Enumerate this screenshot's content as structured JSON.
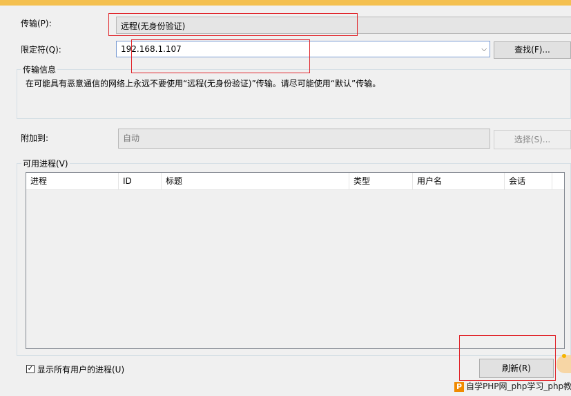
{
  "transport": {
    "label": "传输(P):",
    "value": "远程(无身份验证)"
  },
  "qualifier": {
    "label": "限定符(Q):",
    "value": "192.168.1.107",
    "find_button": "查找(F)..."
  },
  "transport_info": {
    "title": "传输信息",
    "text": "在可能具有恶意通信的网络上永远不要使用“远程(无身份验证)”传输。请尽可能使用“默认”传输。"
  },
  "attach_to": {
    "label": "附加到:",
    "value": "自动",
    "select_button": "选择(S)..."
  },
  "processes": {
    "title": "可用进程(V)",
    "columns": [
      "进程",
      "ID",
      "标题",
      "类型",
      "用户名",
      "会话"
    ],
    "rows": []
  },
  "show_all_users": {
    "label": "显示所有用户的进程(U)",
    "checked": true
  },
  "refresh_button": "刷新(R)",
  "watermark": {
    "icon": "P",
    "text": "自学PHP网_php学习_php教"
  }
}
